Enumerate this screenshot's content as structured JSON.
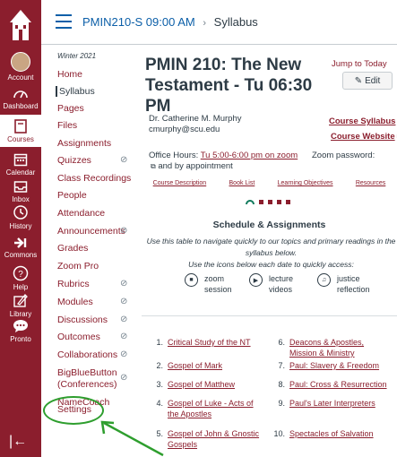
{
  "global_nav": {
    "items": [
      {
        "label": "Account",
        "icon": "avatar-icon"
      },
      {
        "label": "Dashboard",
        "icon": "dashboard-icon"
      },
      {
        "label": "Courses",
        "icon": "courses-icon"
      },
      {
        "label": "Calendar",
        "icon": "calendar-icon"
      },
      {
        "label": "Inbox",
        "icon": "inbox-icon"
      },
      {
        "label": "History",
        "icon": "history-icon"
      },
      {
        "label": "Commons",
        "icon": "commons-icon"
      },
      {
        "label": "Help",
        "icon": "help-icon"
      },
      {
        "label": "Library",
        "icon": "library-icon"
      },
      {
        "label": "Pronto",
        "icon": "chat-icon"
      }
    ],
    "active": "Courses",
    "brand_color": "#8b1e2d"
  },
  "breadcrumb": {
    "course": "PMIN210-S 09:00 AM",
    "separator": "›",
    "current": "Syllabus"
  },
  "course_nav": {
    "term": "Winter 2021",
    "items": [
      {
        "label": "Home"
      },
      {
        "label": "Syllabus"
      },
      {
        "label": "Pages"
      },
      {
        "label": "Files"
      },
      {
        "label": "Assignments"
      },
      {
        "label": "Quizzes"
      },
      {
        "label": "Class Recordings"
      },
      {
        "label": "People"
      },
      {
        "label": "Attendance"
      },
      {
        "label": "Announcements"
      },
      {
        "label": "Grades"
      },
      {
        "label": "Zoom Pro"
      },
      {
        "label": "Rubrics"
      },
      {
        "label": "Modules"
      },
      {
        "label": "Discussions"
      },
      {
        "label": "Outcomes"
      },
      {
        "label": "Collaborations"
      },
      {
        "label": "BigBlueButton (Conferences)"
      },
      {
        "label": "NameCoach"
      },
      {
        "label": "Settings"
      }
    ]
  },
  "main": {
    "title": "PMIN 210: The New Testament - Tu 06:30 PM",
    "jump_label": "Jump to Today",
    "edit_label": "Edit",
    "instructor_name": "Dr. Catherine M. Murphy",
    "instructor_email": "cmurphy@scu.edu",
    "course_syllabus": "Course Syllabus",
    "course_website": "Course Website",
    "office_hours_prefix": "Office Hours:",
    "office_hours_link": "Tu 5:00-6:00 pm on zoom",
    "office_hours_suffix": "and by appointment",
    "zoom_password": "Zoom password:",
    "tabs": [
      "Course Description",
      "Book List",
      "Learning Objectives",
      "Resources"
    ],
    "schedule_title": "Schedule & Assignments",
    "schedule_desc_1": "Use this table to navigate quickly to our topics and primary readings in the syllabus below.",
    "schedule_desc_2": "Use the icons below each date to quickly access:",
    "icon_keys": [
      {
        "label": "zoom session",
        "icon": "zoom-icon"
      },
      {
        "label": "lecture videos",
        "icon": "video-icon"
      },
      {
        "label": "justice reflection",
        "icon": "justice-icon"
      }
    ],
    "topics": [
      {
        "num": "1.",
        "title": "Critical Study of the NT"
      },
      {
        "num": "2.",
        "title": "Gospel of Mark"
      },
      {
        "num": "3.",
        "title": "Gospel of Matthew"
      },
      {
        "num": "4.",
        "title": "Gospel of Luke - Acts of the Apostles"
      },
      {
        "num": "5.",
        "title": "Gospel of John & Gnostic Gospels"
      },
      {
        "num": "6.",
        "title": "Deacons & Apostles, Mission & Ministry"
      },
      {
        "num": "7.",
        "title": "Paul: Slavery & Freedom"
      },
      {
        "num": "8.",
        "title": "Paul: Cross & Resurrection"
      },
      {
        "num": "9.",
        "title": "Paul's Later Interpreters"
      },
      {
        "num": "10.",
        "title": "Spectacles of Salvation"
      }
    ]
  }
}
